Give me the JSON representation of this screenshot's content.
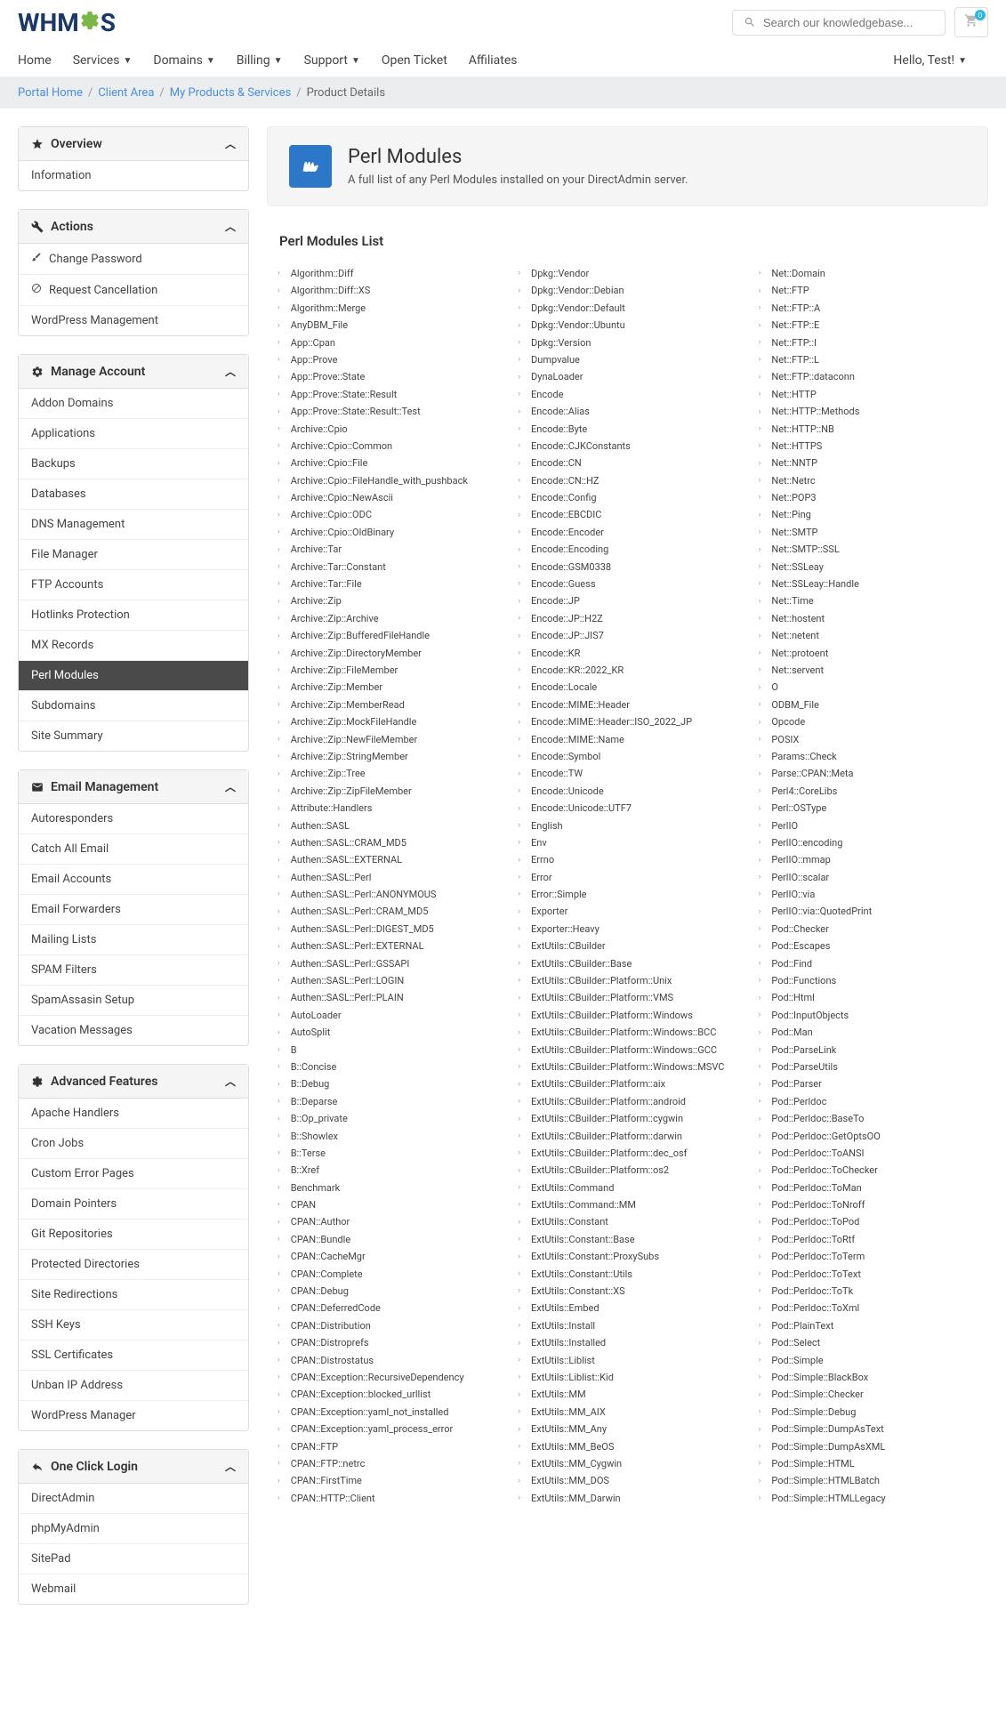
{
  "search": {
    "placeholder": "Search our knowledgebase..."
  },
  "cart": {
    "count": "0"
  },
  "nav": {
    "items": [
      "Home",
      "Services",
      "Domains",
      "Billing",
      "Support",
      "Open Ticket",
      "Affiliates"
    ],
    "dropdowns": [
      false,
      true,
      true,
      true,
      true,
      false,
      false
    ],
    "user": "Hello, Test!"
  },
  "breadcrumb": {
    "items": [
      "Portal Home",
      "Client Area",
      "My Products & Services",
      "Product Details"
    ]
  },
  "page": {
    "title": "Perl Modules",
    "subtitle": "A full list of any Perl Modules installed on your DirectAdmin server."
  },
  "content_title": "Perl Modules List",
  "sidebar": {
    "overview": {
      "title": "Overview",
      "items": [
        "Information"
      ]
    },
    "actions": {
      "title": "Actions",
      "items": [
        "Change Password",
        "Request Cancellation",
        "WordPress Management"
      ],
      "icons": [
        "key",
        "ban",
        ""
      ]
    },
    "manage": {
      "title": "Manage Account",
      "items": [
        "Addon Domains",
        "Applications",
        "Backups",
        "Databases",
        "DNS Management",
        "File Manager",
        "FTP Accounts",
        "Hotlinks Protection",
        "MX Records",
        "Perl Modules",
        "Subdomains",
        "Site Summary"
      ],
      "active": 9
    },
    "email": {
      "title": "Email Management",
      "items": [
        "Autoresponders",
        "Catch All Email",
        "Email Accounts",
        "Email Forwarders",
        "Mailing Lists",
        "SPAM Filters",
        "SpamAssasin Setup",
        "Vacation Messages"
      ]
    },
    "advanced": {
      "title": "Advanced Features",
      "items": [
        "Apache Handlers",
        "Cron Jobs",
        "Custom Error Pages",
        "Domain Pointers",
        "Git Repositories",
        "Protected Directories",
        "Site Redirections",
        "SSH Keys",
        "SSL Certificates",
        "Unban IP Address",
        "WordPress Manager"
      ]
    },
    "oneclick": {
      "title": "One Click Login",
      "items": [
        "DirectAdmin",
        "phpMyAdmin",
        "SitePad",
        "Webmail"
      ]
    }
  },
  "modules": {
    "col1": [
      "Algorithm::Diff",
      "Algorithm::Diff::XS",
      "Algorithm::Merge",
      "AnyDBM_File",
      "App::Cpan",
      "App::Prove",
      "App::Prove::State",
      "App::Prove::State::Result",
      "App::Prove::State::Result::Test",
      "Archive::Cpio",
      "Archive::Cpio::Common",
      "Archive::Cpio::File",
      "Archive::Cpio::FileHandle_with_pushback",
      "Archive::Cpio::NewAscii",
      "Archive::Cpio::ODC",
      "Archive::Cpio::OldBinary",
      "Archive::Tar",
      "Archive::Tar::Constant",
      "Archive::Tar::File",
      "Archive::Zip",
      "Archive::Zip::Archive",
      "Archive::Zip::BufferedFileHandle",
      "Archive::Zip::DirectoryMember",
      "Archive::Zip::FileMember",
      "Archive::Zip::Member",
      "Archive::Zip::MemberRead",
      "Archive::Zip::MockFileHandle",
      "Archive::Zip::NewFileMember",
      "Archive::Zip::StringMember",
      "Archive::Zip::Tree",
      "Archive::Zip::ZipFileMember",
      "Attribute::Handlers",
      "Authen::SASL",
      "Authen::SASL::CRAM_MD5",
      "Authen::SASL::EXTERNAL",
      "Authen::SASL::Perl",
      "Authen::SASL::Perl::ANONYMOUS",
      "Authen::SASL::Perl::CRAM_MD5",
      "Authen::SASL::Perl::DIGEST_MD5",
      "Authen::SASL::Perl::EXTERNAL",
      "Authen::SASL::Perl::GSSAPI",
      "Authen::SASL::Perl::LOGIN",
      "Authen::SASL::Perl::PLAIN",
      "AutoLoader",
      "AutoSplit",
      "B",
      "B::Concise",
      "B::Debug",
      "B::Deparse",
      "B::Op_private",
      "B::Showlex",
      "B::Terse",
      "B::Xref",
      "Benchmark",
      "CPAN",
      "CPAN::Author",
      "CPAN::Bundle",
      "CPAN::CacheMgr",
      "CPAN::Complete",
      "CPAN::Debug",
      "CPAN::DeferredCode",
      "CPAN::Distribution",
      "CPAN::Distroprefs",
      "CPAN::Distrostatus",
      "CPAN::Exception::RecursiveDependency",
      "CPAN::Exception::blocked_urllist",
      "CPAN::Exception::yaml_not_installed",
      "CPAN::Exception::yaml_process_error",
      "CPAN::FTP",
      "CPAN::FTP::netrc",
      "CPAN::FirstTime",
      "CPAN::HTTP::Client"
    ],
    "col2": [
      "Dpkg::Vendor",
      "Dpkg::Vendor::Debian",
      "Dpkg::Vendor::Default",
      "Dpkg::Vendor::Ubuntu",
      "Dpkg::Version",
      "Dumpvalue",
      "DynaLoader",
      "Encode",
      "Encode::Alias",
      "Encode::Byte",
      "Encode::CJKConstants",
      "Encode::CN",
      "Encode::CN::HZ",
      "Encode::Config",
      "Encode::EBCDIC",
      "Encode::Encoder",
      "Encode::Encoding",
      "Encode::GSM0338",
      "Encode::Guess",
      "Encode::JP",
      "Encode::JP::H2Z",
      "Encode::JP::JIS7",
      "Encode::KR",
      "Encode::KR::2022_KR",
      "Encode::Locale",
      "Encode::MIME::Header",
      "Encode::MIME::Header::ISO_2022_JP",
      "Encode::MIME::Name",
      "Encode::Symbol",
      "Encode::TW",
      "Encode::Unicode",
      "Encode::Unicode::UTF7",
      "English",
      "Env",
      "Errno",
      "Error",
      "Error::Simple",
      "Exporter",
      "Exporter::Heavy",
      "ExtUtils::CBuilder",
      "ExtUtils::CBuilder::Base",
      "ExtUtils::CBuilder::Platform::Unix",
      "ExtUtils::CBuilder::Platform::VMS",
      "ExtUtils::CBuilder::Platform::Windows",
      "ExtUtils::CBuilder::Platform::Windows::BCC",
      "ExtUtils::CBuilder::Platform::Windows::GCC",
      "ExtUtils::CBuilder::Platform::Windows::MSVC",
      "ExtUtils::CBuilder::Platform::aix",
      "ExtUtils::CBuilder::Platform::android",
      "ExtUtils::CBuilder::Platform::cygwin",
      "ExtUtils::CBuilder::Platform::darwin",
      "ExtUtils::CBuilder::Platform::dec_osf",
      "ExtUtils::CBuilder::Platform::os2",
      "ExtUtils::Command",
      "ExtUtils::Command::MM",
      "ExtUtils::Constant",
      "ExtUtils::Constant::Base",
      "ExtUtils::Constant::ProxySubs",
      "ExtUtils::Constant::Utils",
      "ExtUtils::Constant::XS",
      "ExtUtils::Embed",
      "ExtUtils::Install",
      "ExtUtils::Installed",
      "ExtUtils::Liblist",
      "ExtUtils::Liblist::Kid",
      "ExtUtils::MM",
      "ExtUtils::MM_AIX",
      "ExtUtils::MM_Any",
      "ExtUtils::MM_BeOS",
      "ExtUtils::MM_Cygwin",
      "ExtUtils::MM_DOS",
      "ExtUtils::MM_Darwin"
    ],
    "col3": [
      "Net::Domain",
      "Net::FTP",
      "Net::FTP::A",
      "Net::FTP::E",
      "Net::FTP::I",
      "Net::FTP::L",
      "Net::FTP::dataconn",
      "Net::HTTP",
      "Net::HTTP::Methods",
      "Net::HTTP::NB",
      "Net::HTTPS",
      "Net::NNTP",
      "Net::Netrc",
      "Net::POP3",
      "Net::Ping",
      "Net::SMTP",
      "Net::SMTP::SSL",
      "Net::SSLeay",
      "Net::SSLeay::Handle",
      "Net::Time",
      "Net::hostent",
      "Net::netent",
      "Net::protoent",
      "Net::servent",
      "O",
      "ODBM_File",
      "Opcode",
      "POSIX",
      "Params::Check",
      "Parse::CPAN::Meta",
      "Perl4::CoreLibs",
      "Perl::OSType",
      "PerlIO",
      "PerlIO::encoding",
      "PerlIO::mmap",
      "PerlIO::scalar",
      "PerlIO::via",
      "PerlIO::via::QuotedPrint",
      "Pod::Checker",
      "Pod::Escapes",
      "Pod::Find",
      "Pod::Functions",
      "Pod::Html",
      "Pod::InputObjects",
      "Pod::Man",
      "Pod::ParseLink",
      "Pod::ParseUtils",
      "Pod::Parser",
      "Pod::Perldoc",
      "Pod::Perldoc::BaseTo",
      "Pod::Perldoc::GetOptsOO",
      "Pod::Perldoc::ToANSI",
      "Pod::Perldoc::ToChecker",
      "Pod::Perldoc::ToMan",
      "Pod::Perldoc::ToNroff",
      "Pod::Perldoc::ToPod",
      "Pod::Perldoc::ToRtf",
      "Pod::Perldoc::ToTerm",
      "Pod::Perldoc::ToText",
      "Pod::Perldoc::ToTk",
      "Pod::Perldoc::ToXml",
      "Pod::PlainText",
      "Pod::Select",
      "Pod::Simple",
      "Pod::Simple::BlackBox",
      "Pod::Simple::Checker",
      "Pod::Simple::Debug",
      "Pod::Simple::DumpAsText",
      "Pod::Simple::DumpAsXML",
      "Pod::Simple::HTML",
      "Pod::Simple::HTMLBatch",
      "Pod::Simple::HTMLLegacy"
    ]
  }
}
